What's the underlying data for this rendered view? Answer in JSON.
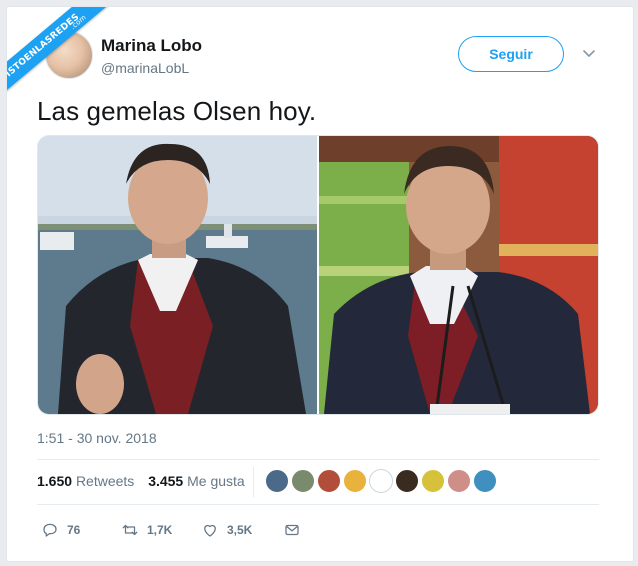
{
  "watermark": {
    "text": "VISTOENLASREDES",
    "sub": ".com"
  },
  "author": {
    "name": "Marina Lobo",
    "handle": "@marinaLobL"
  },
  "follow_label": "Seguir",
  "tweet": {
    "text": "Las gemelas Olsen hoy.",
    "timestamp": "1:51 - 30 nov. 2018"
  },
  "stats": {
    "retweets_count": "1.650",
    "retweets_label": "Retweets",
    "likes_count": "3.455",
    "likes_label": "Me gusta"
  },
  "liker_avatars": [
    "#4b6a8a",
    "#7a8a6d",
    "#b24d3a",
    "#e8b23c",
    "#ffffff",
    "#3a2b20",
    "#d6c23a",
    "#cf8f88",
    "#3f8fbf"
  ],
  "actions": {
    "replies": "76",
    "retweets": "1,7K",
    "likes": "3,5K"
  },
  "icons": {
    "menu": "chevron-down-icon",
    "reply": "reply-icon",
    "retweet": "retweet-icon",
    "like": "heart-icon",
    "dm": "envelope-icon"
  },
  "colors": {
    "accent": "#1da1f2",
    "text": "#14171a",
    "muted": "#657786",
    "divider": "#e6ecf0"
  }
}
